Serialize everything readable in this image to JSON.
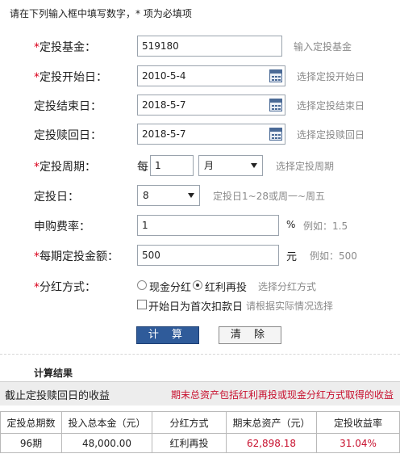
{
  "instruction": "请在下列输入框中填写数字，* 项为必填项",
  "form": {
    "fund": {
      "required": true,
      "label": "定投基金：",
      "value": "519180",
      "hint": "输入定投基金"
    },
    "start_date": {
      "required": true,
      "label": "定投开始日：",
      "value": "2010-5-4",
      "hint": "选择定投开始日",
      "icon": "calendar-icon"
    },
    "end_date": {
      "required": false,
      "label": "定投结束日：",
      "value": "2018-5-7",
      "hint": "选择定投结束日",
      "icon": "calendar-icon"
    },
    "redeem_date": {
      "required": false,
      "label": "定投赎回日：",
      "value": "2018-5-7",
      "hint": "选择定投赎回日",
      "icon": "calendar-icon"
    },
    "period": {
      "required": true,
      "label": "定投周期：",
      "prefix": "每",
      "value": "1",
      "unit_selected": "月",
      "hint": "选择定投周期"
    },
    "invest_day": {
      "required": false,
      "label": "定投日：",
      "selected": "8",
      "hint": "定投日1~28或周一~周五"
    },
    "fee_rate": {
      "required": false,
      "label": "申购费率：",
      "value": "1",
      "unit": "%",
      "hint": "例如：1.5"
    },
    "amount": {
      "required": true,
      "label": "每期定投金额：",
      "value": "500",
      "unit": "元",
      "hint": "例如：500"
    },
    "dividend": {
      "required": true,
      "label": "分红方式：",
      "options": [
        "现金分红",
        "红利再投"
      ],
      "selected": "红利再投",
      "hint": "选择分红方式",
      "first_day_label": "开始日为首次扣款日",
      "first_day_checked": false,
      "first_day_hint": "请根据实际情况选择"
    }
  },
  "buttons": {
    "calculate": "计 算",
    "clear": "清 除"
  },
  "results": {
    "title": "计算结果",
    "summary_left": "截止定投赎回日的收益",
    "summary_right": "期末总资产包括红利再投或现金分红方式取得的收益",
    "columns": [
      "定投总期数",
      "投入总本金（元）",
      "分红方式",
      "期末总资产（元）",
      "定投收益率"
    ],
    "row": [
      "96期",
      "48,000.00",
      "红利再投",
      "62,898.18",
      "31.04%"
    ]
  },
  "colors": {
    "required_star": "#d9001b",
    "primary_button": "#2f5b9a",
    "highlight_red": "#c8102e"
  }
}
